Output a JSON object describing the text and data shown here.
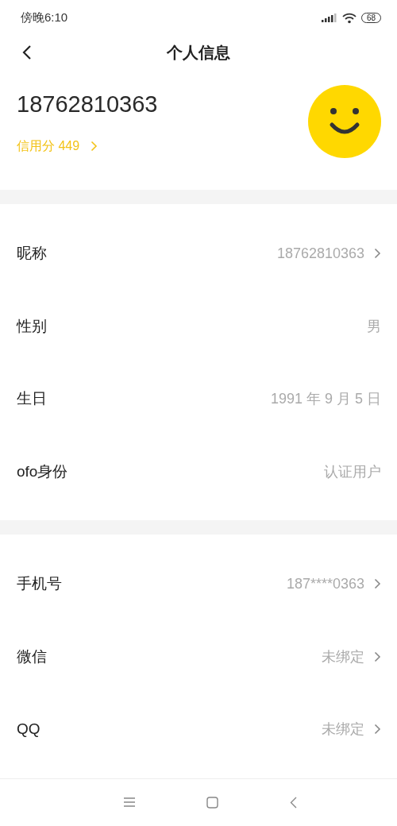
{
  "status_bar": {
    "time": "傍晚6:10",
    "battery": "68"
  },
  "header": {
    "title": "个人信息"
  },
  "profile": {
    "name": "18762810363",
    "credit": "信用分 449"
  },
  "groups": [
    {
      "rows": [
        {
          "label": "昵称",
          "value": "18762810363",
          "chevron": true
        },
        {
          "label": "性别",
          "value": "男",
          "chevron": false
        },
        {
          "label": "生日",
          "value": "1991 年 9 月 5 日",
          "chevron": false
        },
        {
          "label": "ofo身份",
          "value": "认证用户",
          "chevron": false
        }
      ]
    },
    {
      "rows": [
        {
          "label": "手机号",
          "value": "187****0363",
          "chevron": true
        },
        {
          "label": "微信",
          "value": "未绑定",
          "chevron": true
        },
        {
          "label": "QQ",
          "value": "未绑定",
          "chevron": true
        }
      ]
    }
  ]
}
